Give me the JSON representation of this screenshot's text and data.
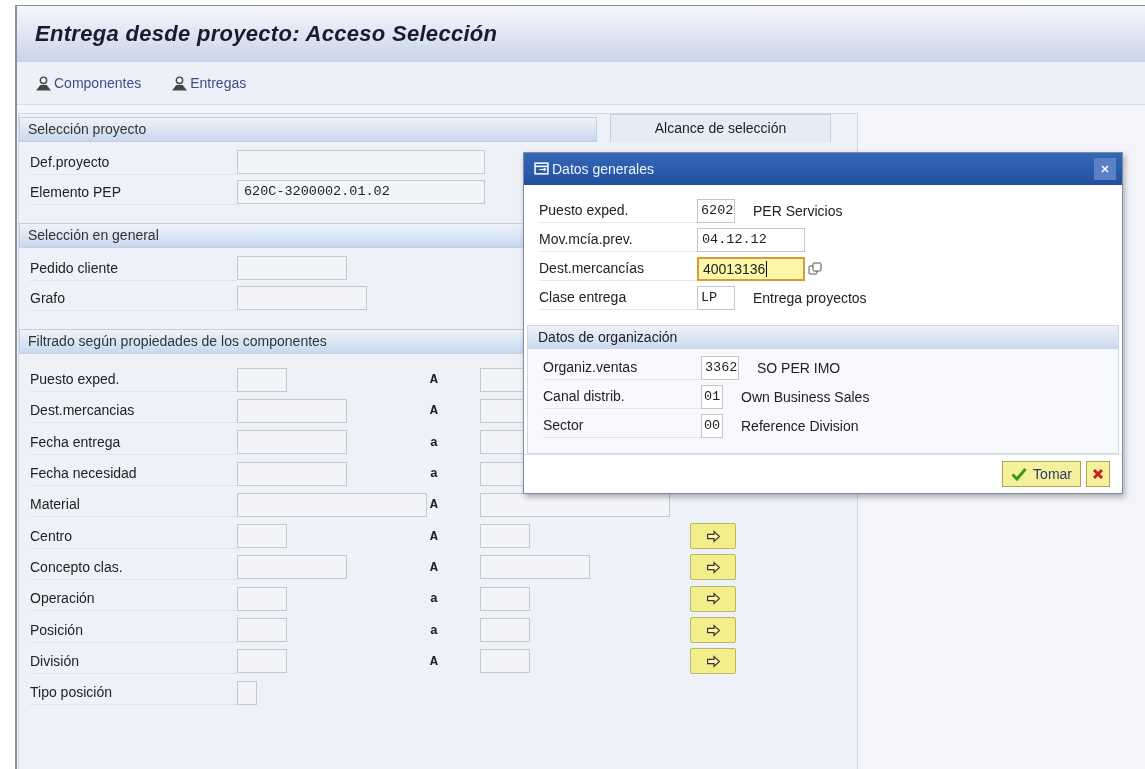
{
  "window": {
    "title": "Entrega desde proyecto: Acceso Selección"
  },
  "toolbar": [
    {
      "label": "Componentes"
    },
    {
      "label": "Entregas"
    }
  ],
  "project_selection": {
    "title": "Selección proyecto",
    "fields": [
      {
        "label": "Def.proyecto"
      },
      {
        "label": "Elemento PEP",
        "value": "620C-3200002.01.02"
      }
    ]
  },
  "scope_tab": {
    "label": "Alcance de selección"
  },
  "general_selection": {
    "title": "Selección en general",
    "fields": [
      {
        "label": "Pedido cliente"
      },
      {
        "label": "Grafo"
      }
    ]
  },
  "component_filter": {
    "title": "Filtrado según propiedades de los componentes",
    "rows": [
      {
        "label": "Puesto exped.",
        "to_word": "A",
        "multi_button": false
      },
      {
        "label": "Dest.mercancias",
        "to_word": "A",
        "multi_button": false
      },
      {
        "label": "Fecha entrega",
        "to_word": "a",
        "multi_button": false
      },
      {
        "label": "Fecha necesidad",
        "to_word": "a",
        "multi_button": false
      },
      {
        "label": "Material",
        "to_word": "A",
        "multi_button": false
      },
      {
        "label": "Centro",
        "to_word": "A",
        "multi_button": true
      },
      {
        "label": "Concepto clas.",
        "to_word": "A",
        "multi_button": true
      },
      {
        "label": "Operación",
        "to_word": "a",
        "multi_button": true
      },
      {
        "label": "Posición",
        "to_word": "a",
        "multi_button": true
      },
      {
        "label": "División",
        "to_word": "A",
        "multi_button": true
      },
      {
        "label": "Tipo posición"
      }
    ]
  },
  "dialog": {
    "title": "Datos generales",
    "fields": [
      {
        "label": "Puesto exped.",
        "value": "6202",
        "description": "PER Servicios",
        "focused": false
      },
      {
        "label": "Mov.mcía.prev.",
        "value": "04.12.12",
        "focused": false
      },
      {
        "label": "Dest.mercancías",
        "value": "40013136",
        "focused": true
      },
      {
        "label": "Clase entrega",
        "value": "LP",
        "description": "Entrega proyectos",
        "focused": false
      }
    ],
    "org_section": {
      "title": "Datos de organización",
      "fields": [
        {
          "label": "Organiz.ventas",
          "value": "3362",
          "description": "SO PER IMO",
          "focused": false
        },
        {
          "label": "Canal distrib.",
          "value": "01",
          "description": "Own Business Sales",
          "focused": false
        },
        {
          "label": "Sector",
          "value": "00",
          "description": "Reference Division",
          "focused": false
        }
      ]
    },
    "buttons": [
      {
        "kind": "confirm",
        "label": "Tomar"
      },
      {
        "kind": "cancel"
      }
    ]
  }
}
